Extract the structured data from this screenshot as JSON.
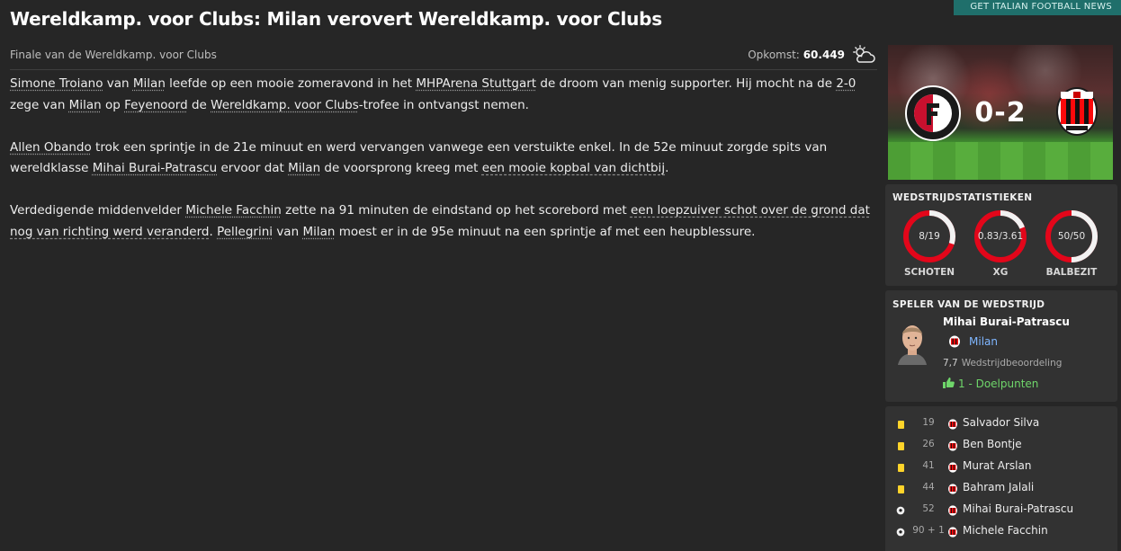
{
  "header": {
    "title": "Wereldkamp. voor Clubs: Milan verovert Wereldkamp. voor Clubs",
    "corner_tag": "GET ITALIAN FOOTBALL NEWS",
    "subtitle": "Finale van de Wereldkamp. voor Clubs",
    "attendance_label": "Opkomst:",
    "attendance_value": "60.449",
    "weather_icon": "partly-cloudy-icon"
  },
  "article": {
    "p1": [
      {
        "t": "Simone Troiano",
        "link": true
      },
      {
        "t": " van "
      },
      {
        "t": "Milan",
        "link": true
      },
      {
        "t": " leefde op een mooie zomeravond in het "
      },
      {
        "t": "MHPArena Stuttgart",
        "link": true
      },
      {
        "t": " de droom van menig supporter. Hij mocht na de "
      },
      {
        "t": "2-0",
        "link": true
      },
      {
        "t": " zege van "
      },
      {
        "t": "Milan",
        "link": true
      },
      {
        "t": " op "
      },
      {
        "t": "Feyenoord",
        "link": true
      },
      {
        "t": " de "
      },
      {
        "t": "Wereldkamp. voor Clubs",
        "link": true
      },
      {
        "t": "-trofee in ontvangst nemen."
      }
    ],
    "p2": [
      {
        "t": "Allen Obando",
        "link": true
      },
      {
        "t": " trok een sprintje in de 21e minuut en werd vervangen vanwege een verstuikte enkel. In de 52e minuut zorgde spits van wereldklasse "
      },
      {
        "t": "Mihai Burai-Patrascu",
        "link": true
      },
      {
        "t": " ervoor dat "
      },
      {
        "t": "Milan",
        "link": true
      },
      {
        "t": " de voorsprong kreeg met "
      },
      {
        "t": "een mooie kopbal van dichtbij",
        "hl": true
      },
      {
        "t": "."
      }
    ],
    "p3": [
      {
        "t": "Verdedigende middenvelder "
      },
      {
        "t": "Michele Facchin",
        "link": true
      },
      {
        "t": " zette na 91 minuten de eindstand op het scorebord met "
      },
      {
        "t": "een loepzuiver schot over de grond dat nog van richting werd veranderd",
        "hl": true
      },
      {
        "t": ". "
      },
      {
        "t": "Pellegrini",
        "link": true
      },
      {
        "t": " van "
      },
      {
        "t": "Milan",
        "link": true
      },
      {
        "t": " moest er in de 95e minuut na een sprintje af met een heupblessure."
      }
    ]
  },
  "match": {
    "score": "0-2",
    "home_crest_icon": "feyenoord-crest-icon",
    "away_crest_icon": "milan-crest-icon",
    "home_color": "#c8102e",
    "away_color": "#fb090b"
  },
  "stats": {
    "title": "WEDSTRIJDSTATISTIEKEN",
    "items": [
      {
        "label": "SCHOTEN",
        "value": "8/19",
        "fraction": 0.3
      },
      {
        "label": "XG",
        "value": "0.83/3.61",
        "fraction": 0.19
      },
      {
        "label": "BALBEZIT",
        "value": "50/50",
        "fraction": 0.5
      }
    ],
    "ring_color": "#e3061a",
    "ring_bg": "#f2f2f2"
  },
  "motm": {
    "title": "SPELER VAN DE WEDSTRIJD",
    "player": "Mihai Burai-Patrascu",
    "club": "Milan",
    "rating": "7,7",
    "rating_label": "Wedstrijdbeoordeling",
    "goals": "1 - Doelpunten"
  },
  "events": [
    {
      "type": "yellow-card",
      "minute": "19",
      "player": "Salvador Silva"
    },
    {
      "type": "yellow-card",
      "minute": "26",
      "player": "Ben Bontje"
    },
    {
      "type": "yellow-card",
      "minute": "41",
      "player": "Murat Arslan"
    },
    {
      "type": "yellow-card",
      "minute": "44",
      "player": "Bahram Jalali"
    },
    {
      "type": "goal",
      "minute": "52",
      "player": "Mihai Burai-Patrascu"
    },
    {
      "type": "goal",
      "minute": "90 + 1",
      "player": "Michele Facchin"
    }
  ]
}
